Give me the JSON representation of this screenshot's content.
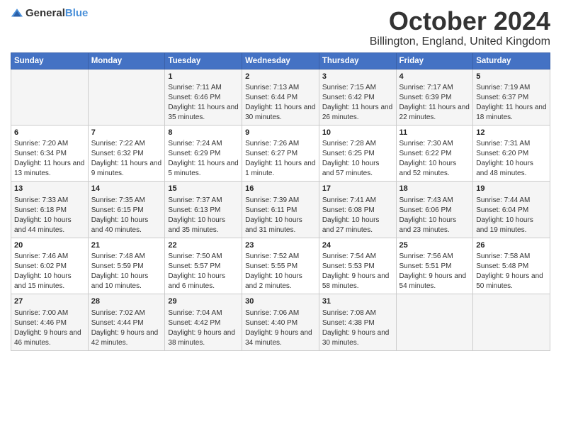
{
  "logo": {
    "text_general": "General",
    "text_blue": "Blue"
  },
  "title": "October 2024",
  "location": "Billington, England, United Kingdom",
  "headers": [
    "Sunday",
    "Monday",
    "Tuesday",
    "Wednesday",
    "Thursday",
    "Friday",
    "Saturday"
  ],
  "weeks": [
    [
      {
        "day": "",
        "sunrise": "",
        "sunset": "",
        "daylight": ""
      },
      {
        "day": "",
        "sunrise": "",
        "sunset": "",
        "daylight": ""
      },
      {
        "day": "1",
        "sunrise": "Sunrise: 7:11 AM",
        "sunset": "Sunset: 6:46 PM",
        "daylight": "Daylight: 11 hours and 35 minutes."
      },
      {
        "day": "2",
        "sunrise": "Sunrise: 7:13 AM",
        "sunset": "Sunset: 6:44 PM",
        "daylight": "Daylight: 11 hours and 30 minutes."
      },
      {
        "day": "3",
        "sunrise": "Sunrise: 7:15 AM",
        "sunset": "Sunset: 6:42 PM",
        "daylight": "Daylight: 11 hours and 26 minutes."
      },
      {
        "day": "4",
        "sunrise": "Sunrise: 7:17 AM",
        "sunset": "Sunset: 6:39 PM",
        "daylight": "Daylight: 11 hours and 22 minutes."
      },
      {
        "day": "5",
        "sunrise": "Sunrise: 7:19 AM",
        "sunset": "Sunset: 6:37 PM",
        "daylight": "Daylight: 11 hours and 18 minutes."
      }
    ],
    [
      {
        "day": "6",
        "sunrise": "Sunrise: 7:20 AM",
        "sunset": "Sunset: 6:34 PM",
        "daylight": "Daylight: 11 hours and 13 minutes."
      },
      {
        "day": "7",
        "sunrise": "Sunrise: 7:22 AM",
        "sunset": "Sunset: 6:32 PM",
        "daylight": "Daylight: 11 hours and 9 minutes."
      },
      {
        "day": "8",
        "sunrise": "Sunrise: 7:24 AM",
        "sunset": "Sunset: 6:29 PM",
        "daylight": "Daylight: 11 hours and 5 minutes."
      },
      {
        "day": "9",
        "sunrise": "Sunrise: 7:26 AM",
        "sunset": "Sunset: 6:27 PM",
        "daylight": "Daylight: 11 hours and 1 minute."
      },
      {
        "day": "10",
        "sunrise": "Sunrise: 7:28 AM",
        "sunset": "Sunset: 6:25 PM",
        "daylight": "Daylight: 10 hours and 57 minutes."
      },
      {
        "day": "11",
        "sunrise": "Sunrise: 7:30 AM",
        "sunset": "Sunset: 6:22 PM",
        "daylight": "Daylight: 10 hours and 52 minutes."
      },
      {
        "day": "12",
        "sunrise": "Sunrise: 7:31 AM",
        "sunset": "Sunset: 6:20 PM",
        "daylight": "Daylight: 10 hours and 48 minutes."
      }
    ],
    [
      {
        "day": "13",
        "sunrise": "Sunrise: 7:33 AM",
        "sunset": "Sunset: 6:18 PM",
        "daylight": "Daylight: 10 hours and 44 minutes."
      },
      {
        "day": "14",
        "sunrise": "Sunrise: 7:35 AM",
        "sunset": "Sunset: 6:15 PM",
        "daylight": "Daylight: 10 hours and 40 minutes."
      },
      {
        "day": "15",
        "sunrise": "Sunrise: 7:37 AM",
        "sunset": "Sunset: 6:13 PM",
        "daylight": "Daylight: 10 hours and 35 minutes."
      },
      {
        "day": "16",
        "sunrise": "Sunrise: 7:39 AM",
        "sunset": "Sunset: 6:11 PM",
        "daylight": "Daylight: 10 hours and 31 minutes."
      },
      {
        "day": "17",
        "sunrise": "Sunrise: 7:41 AM",
        "sunset": "Sunset: 6:08 PM",
        "daylight": "Daylight: 10 hours and 27 minutes."
      },
      {
        "day": "18",
        "sunrise": "Sunrise: 7:43 AM",
        "sunset": "Sunset: 6:06 PM",
        "daylight": "Daylight: 10 hours and 23 minutes."
      },
      {
        "day": "19",
        "sunrise": "Sunrise: 7:44 AM",
        "sunset": "Sunset: 6:04 PM",
        "daylight": "Daylight: 10 hours and 19 minutes."
      }
    ],
    [
      {
        "day": "20",
        "sunrise": "Sunrise: 7:46 AM",
        "sunset": "Sunset: 6:02 PM",
        "daylight": "Daylight: 10 hours and 15 minutes."
      },
      {
        "day": "21",
        "sunrise": "Sunrise: 7:48 AM",
        "sunset": "Sunset: 5:59 PM",
        "daylight": "Daylight: 10 hours and 10 minutes."
      },
      {
        "day": "22",
        "sunrise": "Sunrise: 7:50 AM",
        "sunset": "Sunset: 5:57 PM",
        "daylight": "Daylight: 10 hours and 6 minutes."
      },
      {
        "day": "23",
        "sunrise": "Sunrise: 7:52 AM",
        "sunset": "Sunset: 5:55 PM",
        "daylight": "Daylight: 10 hours and 2 minutes."
      },
      {
        "day": "24",
        "sunrise": "Sunrise: 7:54 AM",
        "sunset": "Sunset: 5:53 PM",
        "daylight": "Daylight: 9 hours and 58 minutes."
      },
      {
        "day": "25",
        "sunrise": "Sunrise: 7:56 AM",
        "sunset": "Sunset: 5:51 PM",
        "daylight": "Daylight: 9 hours and 54 minutes."
      },
      {
        "day": "26",
        "sunrise": "Sunrise: 7:58 AM",
        "sunset": "Sunset: 5:48 PM",
        "daylight": "Daylight: 9 hours and 50 minutes."
      }
    ],
    [
      {
        "day": "27",
        "sunrise": "Sunrise: 7:00 AM",
        "sunset": "Sunset: 4:46 PM",
        "daylight": "Daylight: 9 hours and 46 minutes."
      },
      {
        "day": "28",
        "sunrise": "Sunrise: 7:02 AM",
        "sunset": "Sunset: 4:44 PM",
        "daylight": "Daylight: 9 hours and 42 minutes."
      },
      {
        "day": "29",
        "sunrise": "Sunrise: 7:04 AM",
        "sunset": "Sunset: 4:42 PM",
        "daylight": "Daylight: 9 hours and 38 minutes."
      },
      {
        "day": "30",
        "sunrise": "Sunrise: 7:06 AM",
        "sunset": "Sunset: 4:40 PM",
        "daylight": "Daylight: 9 hours and 34 minutes."
      },
      {
        "day": "31",
        "sunrise": "Sunrise: 7:08 AM",
        "sunset": "Sunset: 4:38 PM",
        "daylight": "Daylight: 9 hours and 30 minutes."
      },
      {
        "day": "",
        "sunrise": "",
        "sunset": "",
        "daylight": ""
      },
      {
        "day": "",
        "sunrise": "",
        "sunset": "",
        "daylight": ""
      }
    ]
  ]
}
